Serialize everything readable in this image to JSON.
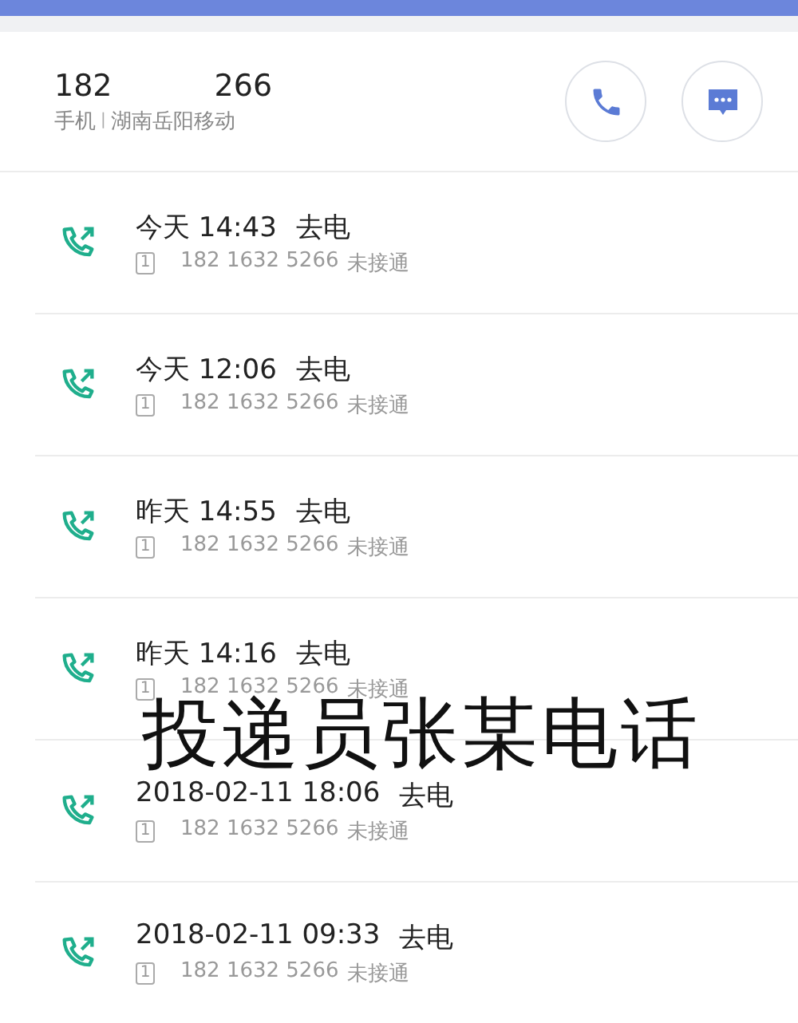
{
  "contact": {
    "number_start": "182",
    "number_end": "266",
    "phone_type": "手机",
    "separator": "|",
    "location": "湖南岳阳移动"
  },
  "calls": [
    {
      "time": "今天 14:43",
      "kind": "outgoing",
      "label": "去电",
      "sim": "1",
      "number": "182 1632 5266",
      "status": "未接通"
    },
    {
      "time": "今天 12:06",
      "kind": "outgoing",
      "label": "去电",
      "sim": "1",
      "number": "182 1632 5266",
      "status": "未接通"
    },
    {
      "time": "昨天 14:55",
      "kind": "outgoing",
      "label": "去电",
      "sim": "1",
      "number": "182 1632 5266",
      "status": "未接通"
    },
    {
      "time": "昨天 14:16",
      "kind": "outgoing",
      "label": "去电",
      "sim": "1",
      "number": "182 1632 5266",
      "status": "未接通"
    },
    {
      "time": "2018-02-11 18:06",
      "kind": "outgoing",
      "label": "去电",
      "sim": "1",
      "number": "182 1632 5266",
      "status": "未接通"
    },
    {
      "time": "2018-02-11 09:33",
      "kind": "outgoing",
      "label": "去电",
      "sim": "1",
      "number": "182 1632 5266",
      "status": "未接通"
    }
  ],
  "caption": "投递员张某电话"
}
